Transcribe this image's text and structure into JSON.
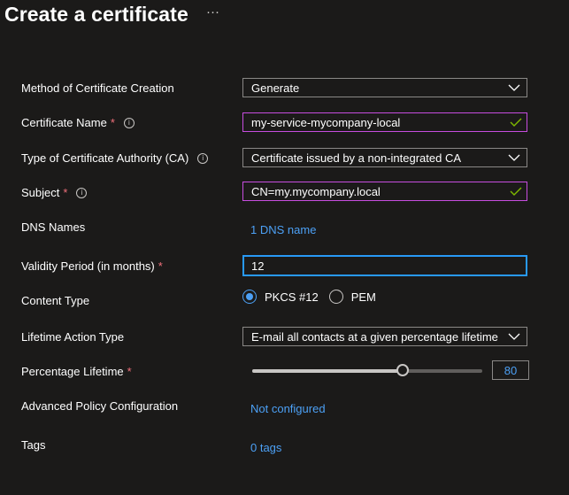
{
  "header": {
    "title": "Create a certificate",
    "more_label": "···"
  },
  "form": {
    "method": {
      "label": "Method of Certificate Creation",
      "value": "Generate"
    },
    "cert_name": {
      "label": "Certificate Name",
      "required": "*",
      "value": "my-service-mycompany-local"
    },
    "ca_type": {
      "label": "Type of Certificate Authority (CA)",
      "value": "Certificate issued by a non-integrated CA"
    },
    "subject": {
      "label": "Subject",
      "required": "*",
      "value": "CN=my.mycompany.local"
    },
    "dns": {
      "label": "DNS Names",
      "link": "1 DNS name"
    },
    "validity": {
      "label": "Validity Period (in months)",
      "required": "*",
      "value": "12"
    },
    "content_type": {
      "label": "Content Type",
      "options": [
        "PKCS #12",
        "PEM"
      ],
      "selected": "PKCS #12"
    },
    "lifetime_action": {
      "label": "Lifetime Action Type",
      "value": "E-mail all contacts at a given percentage lifetime"
    },
    "percentage": {
      "label": "Percentage Lifetime",
      "required": "*",
      "value": "80",
      "min": 0,
      "max": 100
    },
    "advanced": {
      "label": "Advanced Policy Configuration",
      "link": "Not configured"
    },
    "tags": {
      "label": "Tags",
      "link": "0 tags"
    }
  },
  "colors": {
    "background": "#1b1a19",
    "accent": "#4ca0f5",
    "required": "#f1707b",
    "valid_border": "#c74ddf",
    "valid_check": "#7fba00"
  },
  "icons": {
    "info": "info-icon",
    "dropdown": "chevron-down-icon",
    "valid": "checkmark-icon",
    "more": "more-icon"
  }
}
